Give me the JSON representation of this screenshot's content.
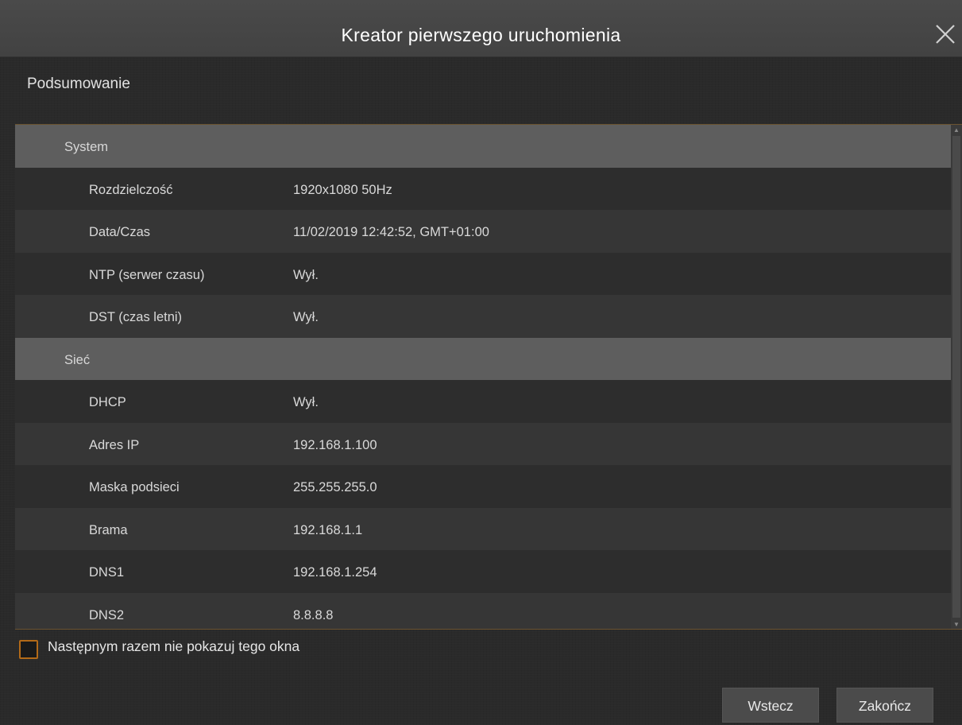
{
  "window": {
    "title": "Kreator pierwszego uruchomienia",
    "close_icon": "close-icon"
  },
  "section": {
    "title": "Podsumowanie"
  },
  "summary": {
    "system_label": "System",
    "system_rows": [
      {
        "key": "Rozdzielczość",
        "value": "1920x1080 50Hz"
      },
      {
        "key": "Data/Czas",
        "value": "11/02/2019 12:42:52, GMT+01:00"
      },
      {
        "key": "NTP (serwer czasu)",
        "value": "Wył."
      },
      {
        "key": "DST (czas letni)",
        "value": "Wył."
      }
    ],
    "network_label": "Sieć",
    "network_rows": [
      {
        "key": "DHCP",
        "value": "Wył."
      },
      {
        "key": "Adres IP",
        "value": "192.168.1.100"
      },
      {
        "key": "Maska podsieci",
        "value": "255.255.255.0"
      },
      {
        "key": "Brama",
        "value": "192.168.1.1"
      },
      {
        "key": "DNS1",
        "value": "192.168.1.254"
      },
      {
        "key": "DNS2",
        "value": "8.8.8.8"
      }
    ]
  },
  "options": {
    "dont_show_label": "Następnym razem nie pokazuj tego okna",
    "dont_show_checked": false
  },
  "buttons": {
    "back_label": "Wstecz",
    "finish_label": "Zakończ"
  },
  "colors": {
    "accent": "#b36a18",
    "group_row": "#5e5e5e",
    "titlebar": "#464646"
  }
}
